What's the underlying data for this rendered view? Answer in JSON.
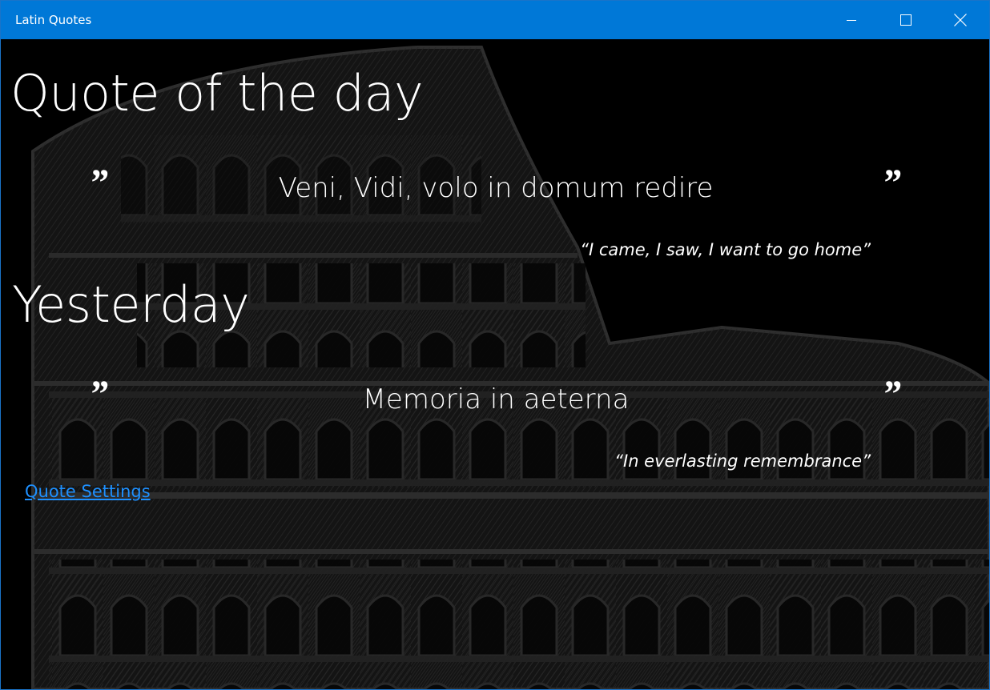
{
  "window": {
    "title": "Latin Quotes",
    "titlebar_color": "#0078d7",
    "controls": [
      "minimize-icon",
      "maximize-icon",
      "close-icon"
    ]
  },
  "today": {
    "heading": "Quote of the day",
    "open_mark": "”",
    "close_mark": "”",
    "latin": "Veni, Vidi, volo in domum redire",
    "english": "“I came, I saw, I want to go home”"
  },
  "yesterday": {
    "heading": "Yesterday",
    "open_mark": "”",
    "close_mark": "”",
    "latin": "Memoria in aeterna",
    "english": "“In everlasting remembrance”"
  },
  "settings_link": {
    "label": "Quote Settings",
    "color": "#1e90ff"
  },
  "background": {
    "image": "colosseum-illustration",
    "color": "#000000"
  }
}
